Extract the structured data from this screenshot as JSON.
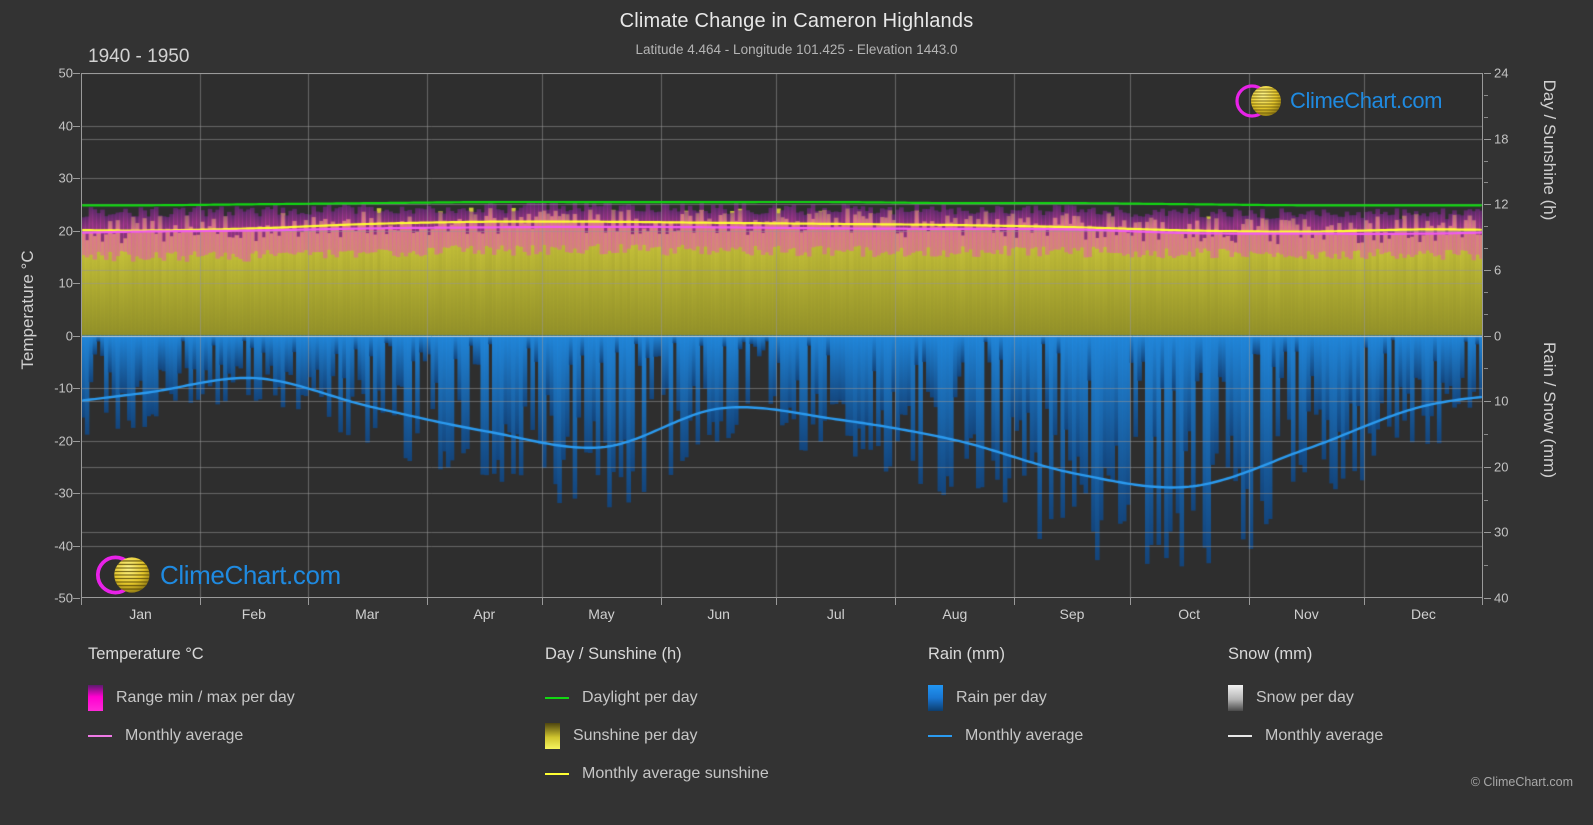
{
  "header": {
    "title": "Climate Change in Cameron Highlands",
    "subtitle": "Latitude 4.464 - Longitude 101.425 - Elevation 1443.0",
    "period": "1940 - 1950"
  },
  "branding": {
    "logo_text": "ClimeChart.com",
    "copyright": "© ClimeChart.com"
  },
  "axes": {
    "left_title": "Temperature °C",
    "right_title_top": "Day / Sunshine (h)",
    "right_title_bottom": "Rain / Snow (mm)",
    "left_ticks": [
      "50",
      "40",
      "30",
      "20",
      "10",
      "0",
      "-10",
      "-20",
      "-30",
      "-40",
      "-50"
    ],
    "right_ticks_top": [
      "24",
      "18",
      "12",
      "6",
      "0"
    ],
    "right_ticks_bottom": [
      "10",
      "20",
      "30",
      "40"
    ]
  },
  "legend": {
    "temperature": {
      "title": "Temperature °C",
      "items": [
        {
          "label": "Range min / max per day",
          "marker": "gradient-box",
          "color": "#ff00d0"
        },
        {
          "label": "Monthly average",
          "marker": "line",
          "color": "#ef7ae6"
        }
      ]
    },
    "sunshine": {
      "title": "Day / Sunshine (h)",
      "items": [
        {
          "label": "Daylight per day",
          "marker": "line",
          "color": "#12d812"
        },
        {
          "label": "Sunshine per day",
          "marker": "gradient-box",
          "color": "#f2f24a"
        },
        {
          "label": "Monthly average sunshine",
          "marker": "line",
          "color": "#ffff33"
        }
      ]
    },
    "rain": {
      "title": "Rain (mm)",
      "items": [
        {
          "label": "Rain per day",
          "marker": "gradient-box",
          "color": "#1f8ae0"
        },
        {
          "label": "Monthly average",
          "marker": "line",
          "color": "#2b9bf0"
        }
      ]
    },
    "snow": {
      "title": "Snow (mm)",
      "items": [
        {
          "label": "Snow per day",
          "marker": "gradient-box",
          "color": "#e8e8e8"
        },
        {
          "label": "Monthly average",
          "marker": "line",
          "color": "#e8e8e8"
        }
      ]
    }
  },
  "chart_data": {
    "type": "area",
    "title": "Climate Change in Cameron Highlands",
    "subtitle": "Latitude 4.464 - Longitude 101.425 - Elevation 1443.0",
    "period": "1940 - 1950",
    "categories": [
      "Jan",
      "Feb",
      "Mar",
      "Apr",
      "May",
      "Jun",
      "Jul",
      "Aug",
      "Sep",
      "Oct",
      "Nov",
      "Dec"
    ],
    "xlabel": "",
    "ylabel": "Temperature °C",
    "ylim": [
      -50,
      50
    ],
    "y2_top_label": "Day / Sunshine (h)",
    "y2_top_lim": [
      0,
      24
    ],
    "y2_bottom_label": "Rain / Snow (mm)",
    "y2_bottom_lim": [
      0,
      40
    ],
    "grid": true,
    "legend_position": "below",
    "series": [
      {
        "name": "Monthly average",
        "group": "temperature",
        "unit": "°C",
        "color": "#ef7ae6",
        "values": [
          19.8,
          20.0,
          20.4,
          20.6,
          20.7,
          20.6,
          20.4,
          20.3,
          20.2,
          19.5,
          19.4,
          19.4
        ]
      },
      {
        "name": "Range min / max per day",
        "group": "temperature",
        "unit": "°C",
        "color": "#ff00d0",
        "min_values": [
          15.0,
          15.2,
          15.6,
          16.2,
          16.4,
          16.2,
          16.0,
          16.0,
          15.9,
          15.6,
          15.5,
          15.3
        ],
        "max_values": [
          23.5,
          23.8,
          24.2,
          24.3,
          24.4,
          24.2,
          24.0,
          24.0,
          23.8,
          23.3,
          23.2,
          23.2
        ]
      },
      {
        "name": "Daylight per day",
        "group": "sunshine",
        "unit": "h",
        "color": "#12d812",
        "values": [
          11.9,
          12.0,
          12.1,
          12.2,
          12.2,
          12.2,
          12.2,
          12.1,
          12.1,
          12.0,
          11.9,
          11.9
        ]
      },
      {
        "name": "Monthly average sunshine",
        "group": "sunshine",
        "unit": "h",
        "color": "#ffff33",
        "values": [
          9.6,
          9.8,
          10.2,
          10.4,
          10.4,
          10.3,
          10.2,
          10.1,
          9.9,
          9.6,
          9.5,
          9.7
        ]
      },
      {
        "name": "Monthly average",
        "group": "rain",
        "unit": "mm",
        "color": "#2b9bf0",
        "values": [
          8.8,
          6.5,
          10.8,
          14.6,
          17.0,
          11.1,
          12.8,
          16.0,
          21.0,
          23.0,
          17.2,
          10.7
        ]
      }
    ]
  }
}
